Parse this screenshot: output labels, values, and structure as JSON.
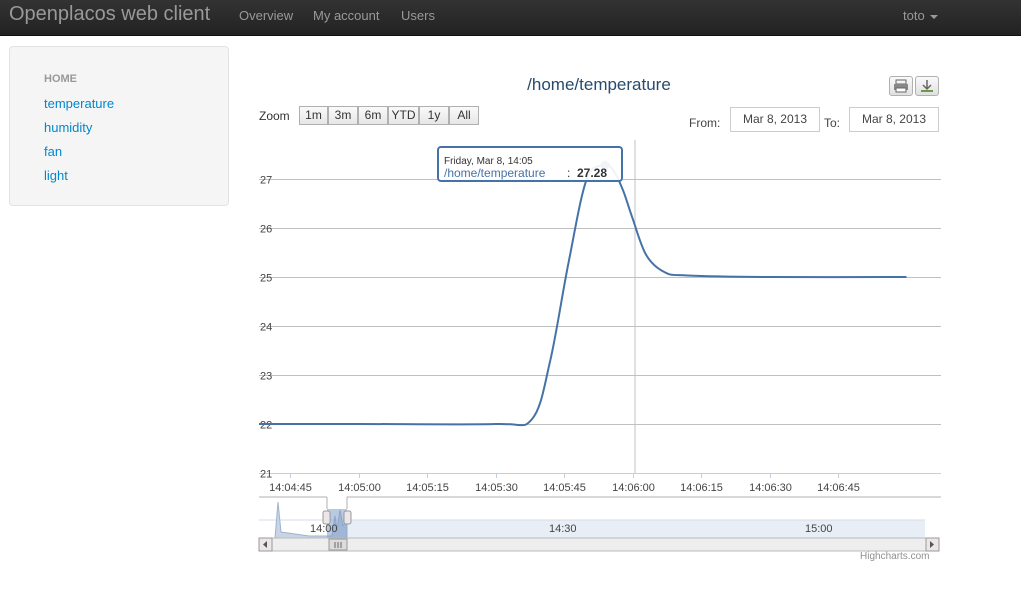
{
  "navbar": {
    "brand": "Openplacos web client",
    "links": [
      "Overview",
      "My account",
      "Users"
    ],
    "user": "toto"
  },
  "sidebar": {
    "header": "HOME",
    "items": [
      "temperature",
      "humidity",
      "fan",
      "light"
    ]
  },
  "chart": {
    "title": "/home/temperature",
    "zoom_label": "Zoom",
    "zoom_buttons": [
      "1m",
      "3m",
      "6m",
      "YTD",
      "1y",
      "All"
    ],
    "from_label": "From:",
    "from_value": "Mar 8, 2013",
    "to_label": "To:",
    "to_value": "Mar 8, 2013",
    "tooltip_date": "Friday, Mar 8, 14:05",
    "tooltip_series": "/home/temperature",
    "tooltip_sep": ":",
    "tooltip_value": "27.28",
    "navigator_labels": [
      "14:00",
      "14:30",
      "15:00"
    ],
    "credits": "Highcharts.com",
    "accent_color": "#4572a7"
  },
  "chart_data": {
    "type": "line",
    "title": "/home/temperature",
    "xlabel": "",
    "ylabel": "",
    "ylim": [
      21,
      28
    ],
    "yticks": [
      21,
      22,
      23,
      24,
      25,
      26,
      27
    ],
    "xticks": [
      "14:04:45",
      "14:05:00",
      "14:05:15",
      "14:05:30",
      "14:05:45",
      "14:06:00",
      "14:06:15",
      "14:06:30",
      "14:06:45"
    ],
    "x": [
      "14:04:33",
      "14:05:00",
      "14:05:30",
      "14:05:38",
      "14:05:42",
      "14:05:46",
      "14:05:50",
      "14:05:54",
      "14:05:56",
      "14:05:58",
      "14:06:00",
      "14:06:03",
      "14:06:07",
      "14:06:12",
      "14:06:30",
      "14:07:00"
    ],
    "series": [
      {
        "name": "/home/temperature",
        "color": "#4572a7",
        "values": [
          22.0,
          22.0,
          22.0,
          22.1,
          23.3,
          25.3,
          27.0,
          27.28,
          27.15,
          26.75,
          26.2,
          25.45,
          25.1,
          25.03,
          25.0,
          25.0
        ]
      }
    ],
    "grid": true,
    "legend": "none"
  }
}
